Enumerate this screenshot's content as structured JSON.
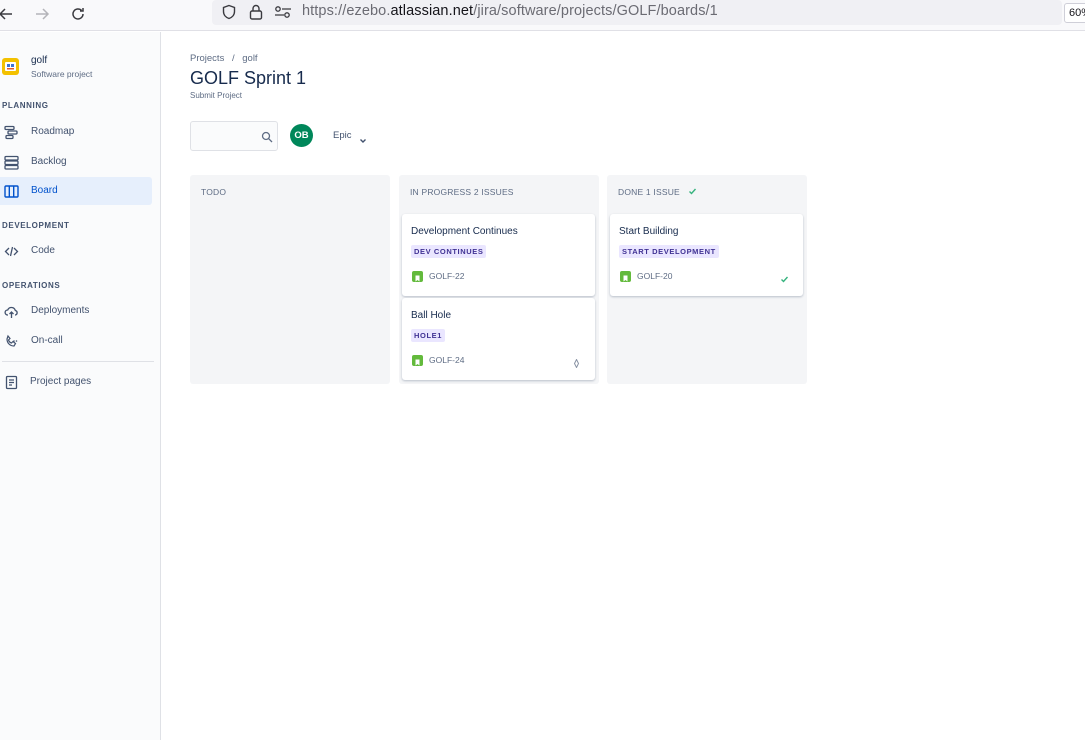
{
  "browser": {
    "url_prefix": "https://ezebo.",
    "url_domain": "atlassian.net",
    "url_path": "/jira/software/projects/GOLF/boards/1",
    "zoom": "60%"
  },
  "sidebar": {
    "project_name": "golf",
    "project_type": "Software project",
    "sections": {
      "planning": "PLANNING",
      "development": "DEVELOPMENT",
      "operations": "OPERATIONS"
    },
    "items": [
      {
        "label": "Roadmap",
        "icon": "roadmap-icon"
      },
      {
        "label": "Backlog",
        "icon": "backlog-icon"
      },
      {
        "label": "Board",
        "icon": "board-icon",
        "active": true
      },
      {
        "label": "Code",
        "icon": "code-icon"
      },
      {
        "label": "Deployments",
        "icon": "cloud-upload-icon"
      },
      {
        "label": "On-call",
        "icon": "phone-icon"
      },
      {
        "label": "Project pages",
        "icon": "page-icon"
      }
    ]
  },
  "header": {
    "breadcrumb": [
      "Projects",
      "/",
      "golf"
    ],
    "title": "GOLF Sprint 1",
    "subtitle": "Submit Project"
  },
  "filters": {
    "search_placeholder": "",
    "avatar_initials": "OB",
    "epic_label": "Epic"
  },
  "columns": [
    {
      "name": "TODO",
      "count": "",
      "cards": []
    },
    {
      "name": "IN PROGRESS",
      "count": "2 ISSUES",
      "cards": [
        {
          "title": "Development Continues",
          "epic": "DEV CONTINUES",
          "key": "GOLF-22",
          "meta": ""
        },
        {
          "title": "Ball Hole",
          "epic": "HOLE1",
          "key": "GOLF-24",
          "meta": "priority-icon"
        }
      ]
    },
    {
      "name": "DONE",
      "count": "1 ISSUE",
      "cards": [
        {
          "title": "Start Building",
          "epic": "START DEVELOPMENT",
          "key": "GOLF-20",
          "meta": "check-icon"
        }
      ]
    }
  ],
  "colors": {
    "accent": "#0052cc",
    "active_bg": "#e6effc",
    "avatar_bg": "#00875a",
    "epic_bg": "#eae6ff",
    "epic_text": "#403294",
    "story_icon": "#63ba3c",
    "done_check": "#36b37e"
  }
}
